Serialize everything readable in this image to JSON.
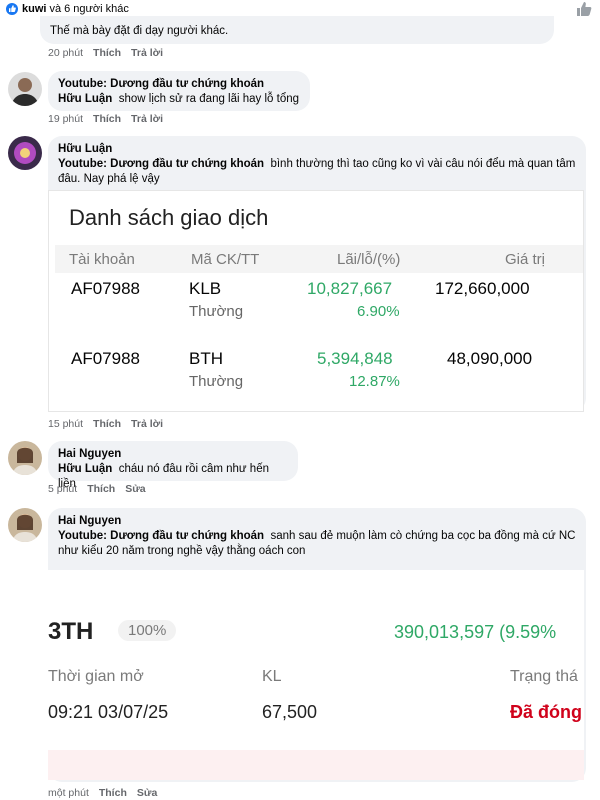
{
  "top": {
    "name": "kuwi",
    "rest": "và 6 người khác"
  },
  "comments": [
    {
      "text": "Thế mà bày đặt đi dạy người khác.",
      "time": "20 phút",
      "like": "Thích",
      "reply": "Trả lời"
    },
    {
      "author": "Youtube: Dương đầu tư chứng khoán",
      "tag": "Hữu Luận",
      "text": "show lịch sử ra đang lãi hay lỗ tổng",
      "time": "19 phút",
      "like": "Thích",
      "reply": "Trả lời"
    },
    {
      "author": "Hữu Luận",
      "tag": "Youtube: Dương đầu tư chứng khoán",
      "text": "bình thường thì tao cũng ko vì vài câu nói đểu mà quan tâm đâu. Nay phá lệ vậy",
      "time": "15 phút",
      "like": "Thích",
      "reply": "Trả lời"
    },
    {
      "author": "Hai Nguyen",
      "tag": "Hữu Luận",
      "text": "cháu nó đâu rồi câm như hến liền",
      "time": "5 phút",
      "like": "Thích",
      "reply": "Sửa"
    },
    {
      "author": "Hai Nguyen",
      "tag": "Youtube: Dương đầu tư chứng khoán",
      "text": "sanh sau đẻ muộn làm cò chứng ba cọc ba đồng mà cứ NC như kiểu 20 năm trong nghề vậy thằng oách con",
      "time": "một phút",
      "like": "Thích",
      "reply": "Sửa"
    }
  ],
  "trade_list": {
    "title": "Danh sách giao dịch",
    "headers": [
      "Tài khoản",
      "Mã CK/TT",
      "Lãi/lỗ/(%)",
      "Giá trị"
    ],
    "rows": [
      {
        "account": "AF07988",
        "symbol": "KLB",
        "type": "Thường",
        "pnl": "10,827,667",
        "pct": "6.90%",
        "value": "172,660,000"
      },
      {
        "account": "AF07988",
        "symbol": "BTH",
        "type": "Thường",
        "pnl": "5,394,848",
        "pct": "12.87%",
        "value": "48,090,000"
      }
    ]
  },
  "position": {
    "symbol": "3TH",
    "badge": "100%",
    "profit": "390,013,597 (9.59%",
    "open_label": "Thời gian mở",
    "open_value": "09:21 03/07/25",
    "qty_label": "KL",
    "qty_value": "67,500",
    "status_label": "Trạng thá",
    "status_value": "Đã đóng"
  },
  "colors": {
    "like_blue": "#1877f2",
    "green": "#2fa866",
    "red": "#d0021b",
    "bubble": "#f0f2f5"
  }
}
